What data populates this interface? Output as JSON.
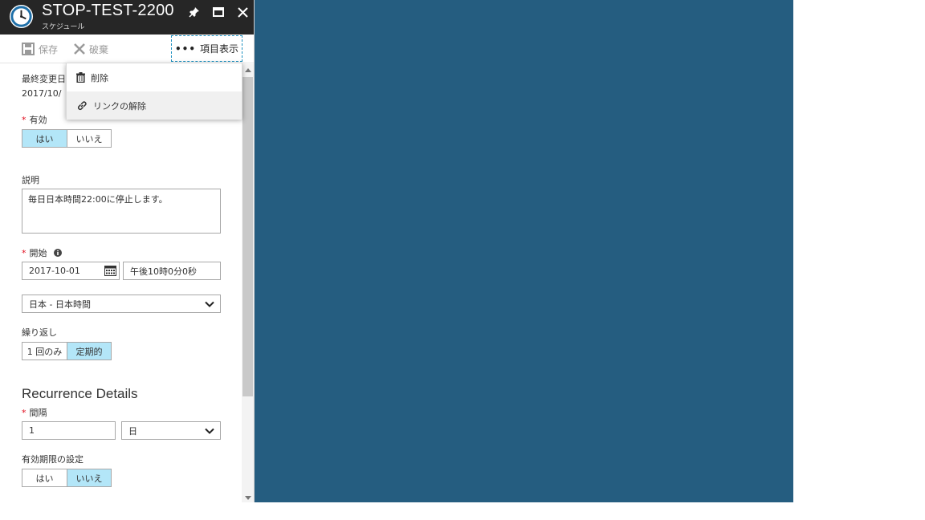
{
  "window": {
    "title": "STOP-TEST-2200",
    "subtitle": "スケジュール"
  },
  "toolbar": {
    "save_label": "保存",
    "discard_label": "破棄",
    "more_label": "項目表示"
  },
  "menu": {
    "items": [
      {
        "label": "削除",
        "icon": "trash-icon"
      },
      {
        "label": "リンクの解除",
        "icon": "link-icon"
      }
    ]
  },
  "form": {
    "last_modified_label": "最終変更日",
    "last_modified_value": "2017/10/",
    "enabled_label": "有効",
    "enabled_options": [
      "はい",
      "いいえ"
    ],
    "enabled_selected": "はい",
    "description_label": "説明",
    "description_value": "毎日日本時間22:00に停止します。",
    "start_label": "開始",
    "start_date": "2017-10-01",
    "start_time": "午後10時0分0秒",
    "timezone_value": "日本 - 日本時間",
    "recurrence_label": "繰り返し",
    "recurrence_options": [
      "1 回のみ",
      "定期的"
    ],
    "recurrence_selected": "定期的",
    "recurrence_details_title": "Recurrence Details",
    "interval_label": "間隔",
    "interval_value": "1",
    "interval_unit": "日",
    "expiration_label": "有効期限の設定",
    "expiration_options": [
      "はい",
      "いいえ"
    ],
    "expiration_selected": "いいえ"
  },
  "colors": {
    "background_blue": "#255d80",
    "title_bar": "#262626",
    "selected_toggle": "#b3e6f8",
    "required_asterisk": "#e00b1c",
    "focus_border": "#1b8fbf"
  }
}
